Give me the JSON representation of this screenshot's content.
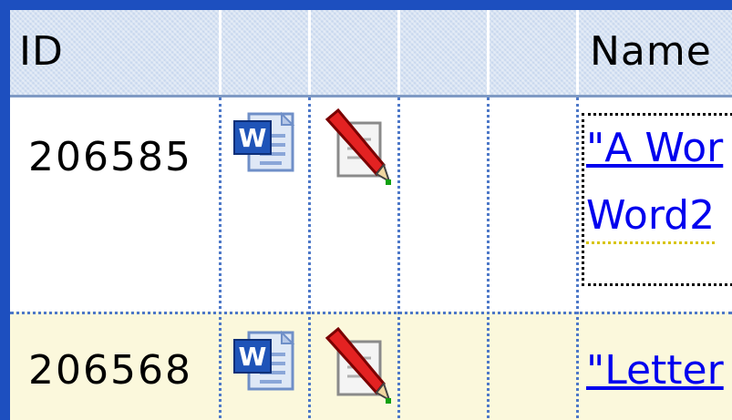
{
  "table": {
    "columns": [
      "ID",
      "",
      "",
      "",
      "",
      "Name"
    ],
    "rows": [
      {
        "id": "206585",
        "name_line1": "\"A Wor",
        "name_line2": "Word2",
        "doc_icon": "word-document-icon",
        "edit_icon": "edit-pencil-icon"
      },
      {
        "id": "206568",
        "name_line1": "\"Letter",
        "doc_icon": "word-document-icon",
        "edit_icon": "edit-pencil-icon"
      }
    ]
  },
  "colors": {
    "frame": "#1d4fbf",
    "header_bg": "#c9d8ee",
    "grid_line": "#4d78c8",
    "alt_row_bg": "#fbf8dc",
    "link": "#0000ee"
  }
}
